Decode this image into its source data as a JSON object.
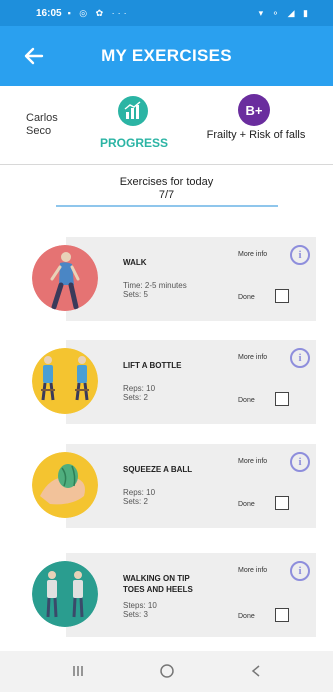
{
  "status_bar": {
    "time": "16:05",
    "left_icons": "▪ ◎ ✿ ···",
    "right_icons": "▾ ⚬ ◢ ▮"
  },
  "app_bar": {
    "title": "MY EXERCISES"
  },
  "summary": {
    "user_name": "Carlos Seco",
    "progress_label": "PROGRESS",
    "level_badge": "B+",
    "level_label": "Frailty + Risk of falls"
  },
  "today": {
    "label": "Exercises for today",
    "count": "7/7"
  },
  "exercises": [
    {
      "name": "WALK",
      "line1": "Time: 2-5 minutes",
      "line2": "Sets: 5",
      "more_info": "More info",
      "done": "Done",
      "info_glyph": "i"
    },
    {
      "name": "LIFT A BOTTLE",
      "line1": "Reps: 10",
      "line2": "Sets: 2",
      "more_info": "More info",
      "done": "Done",
      "info_glyph": "i"
    },
    {
      "name": "SQUEEZE A BALL",
      "line1": "Reps: 10",
      "line2": "Sets: 2",
      "more_info": "More info",
      "done": "Done",
      "info_glyph": "i"
    },
    {
      "name": "WALKING ON TIP TOES AND HEELS",
      "line1": "Steps: 10",
      "line2": "Sets: 3",
      "more_info": "More info",
      "done": "Done",
      "info_glyph": "i"
    }
  ],
  "colors": {
    "app_bar": "#2aa0ef",
    "status_bar": "#1e8fdc",
    "progress_accent": "#2bb4a4",
    "level_badge": "#6a2d9e",
    "info_icon": "#8e8edc",
    "walk_avatar": "#e57373",
    "lift_avatar": "#f4c430",
    "squeeze_avatar": "#f4c430",
    "tiptoe_avatar": "#2a9d8f"
  }
}
